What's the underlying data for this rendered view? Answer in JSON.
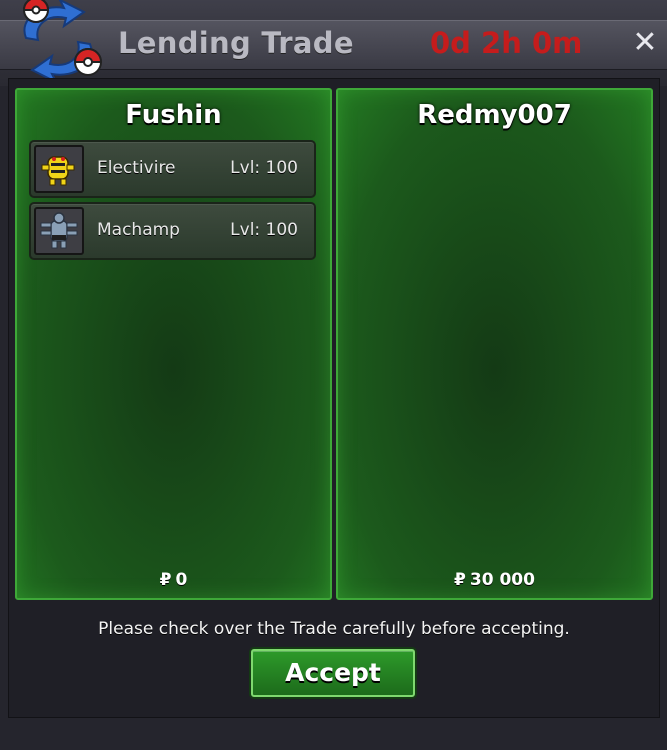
{
  "window": {
    "title": "Lending Trade",
    "timer": "0d 2h 0m",
    "close_symbol": "✕",
    "logo_icon": "trade-arrows-pokeball-icon"
  },
  "left_panel": {
    "player": "Fushin",
    "pokemon": [
      {
        "name": "Electivire",
        "level": "Lvl: 100",
        "icon": "electivire-sprite-icon"
      },
      {
        "name": "Machamp",
        "level": "Lvl: 100",
        "icon": "machamp-sprite-icon"
      }
    ],
    "currency_symbol": "₽",
    "money": "0"
  },
  "right_panel": {
    "player": "Redmy007",
    "pokemon": [],
    "currency_symbol": "₽",
    "money": "30 000"
  },
  "notice": "Please check over the Trade carefully before accepting.",
  "accept_label": "Accept",
  "colors": {
    "timer": "#c51c1c",
    "panel_border": "#3ea838",
    "panel_bg": "#1c5a1c",
    "accept_bg": "#2d9a2a"
  }
}
